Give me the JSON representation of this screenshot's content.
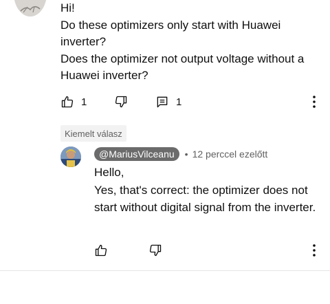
{
  "comment": {
    "lines": [
      "Hi!",
      "Do these optimizers only start with Huawei inverter?",
      "Does the optimizer not output voltage without a Huawei inverter?"
    ],
    "like_count": "1",
    "reply_count": "1"
  },
  "pinned_label": "Kiemelt válasz",
  "reply": {
    "author": "@MariusVilceanu",
    "separator": "•",
    "time": "12 perccel ezelőtt",
    "lines": [
      "Hello,",
      "Yes, that's correct: the optimizer does not start without digital signal from the inverter."
    ]
  },
  "icons": {
    "like": "thumb-up-icon",
    "dislike": "thumb-down-icon",
    "reply": "comment-icon",
    "more": "more-vert-icon"
  }
}
